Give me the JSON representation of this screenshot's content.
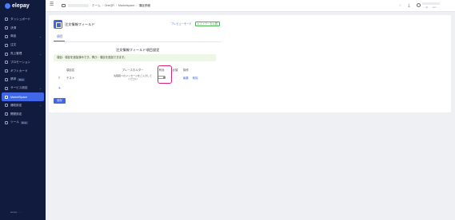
{
  "app": {
    "logo_text": "elepay"
  },
  "sidebar": {
    "items": [
      {
        "label": "ダッシュボード",
        "has_chevron": false,
        "badge": ""
      },
      {
        "label": "決済",
        "has_chevron": false,
        "badge": ""
      },
      {
        "label": "商品",
        "has_chevron": true,
        "badge": ""
      },
      {
        "label": "注文",
        "has_chevron": false,
        "badge": ""
      },
      {
        "label": "売上管理",
        "has_chevron": true,
        "badge": ""
      },
      {
        "label": "プロモーション",
        "has_chevron": false,
        "badge": ""
      },
      {
        "label": "ギフトカード",
        "has_chevron": false,
        "badge": ""
      },
      {
        "label": "請求",
        "has_chevron": false,
        "badge": "Beta"
      },
      {
        "label": "サービス設定",
        "has_chevron": true,
        "badge": ""
      },
      {
        "label": "MarketSpace",
        "has_chevron": false,
        "badge": "",
        "active": true
      },
      {
        "label": "通知設定",
        "has_chevron": true,
        "badge": ""
      },
      {
        "label": "開発設定",
        "has_chevron": false,
        "badge": ""
      },
      {
        "label": "ツール",
        "has_chevron": false,
        "badge": "Beta"
      }
    ],
    "footer": "elepay ··· ···"
  },
  "header": {
    "menu_icon": "hamburger-icon",
    "breadcrumb": [
      "ホーム",
      "OneQR",
      "Marketspace",
      "項目詳細"
    ],
    "user_email": "·····@······.com"
  },
  "card": {
    "title": "注文情報フィールド",
    "btn_preview": "プレビューモード",
    "btn_publish": "● ストアーを公開",
    "tab_label": "項目",
    "section_title": "注文情報フィールド項目設定",
    "notice": "項目：項目を追加済みです。再び：項目を追加できます。",
    "table": {
      "headers": {
        "drag": "",
        "name": "項目名",
        "placeholder": "プレースホルダー",
        "enabled": "有効",
        "required": "必須",
        "ops": "操作"
      },
      "rows": [
        {
          "name": "テスト",
          "placeholder": "先程取へのメッセージをご入力してください",
          "enabled": true,
          "required": "-",
          "edit": "編集",
          "delete": "削除"
        }
      ]
    },
    "add_label": "+",
    "save_label": "保存"
  },
  "colors": {
    "accent": "#3f67e8",
    "sidebar_bg": "#111b3d",
    "highlight": "#d6237a",
    "notice_bg": "#eef6e6"
  }
}
